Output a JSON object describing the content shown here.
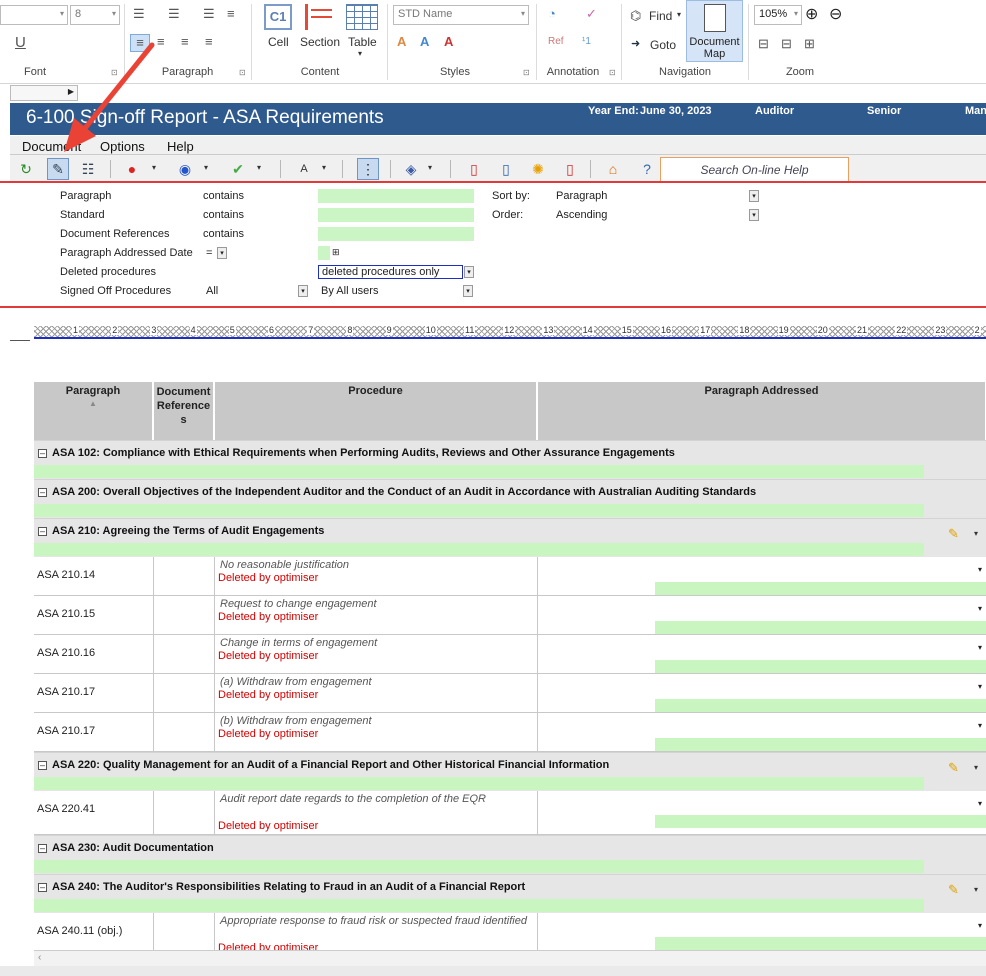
{
  "ribbon": {
    "font_size_value": "8",
    "groups": {
      "font": "Font",
      "paragraph": "Paragraph",
      "content": "Content",
      "styles": "Styles",
      "annotation": "Annotation",
      "navigation": "Navigation",
      "zoom": "Zoom"
    },
    "content_buttons": {
      "cell": "Cell",
      "section": "Section",
      "table": "Table",
      "cell_icon": "C1"
    },
    "style_value": "STD Name",
    "underline_label": "U",
    "find_label": "Find",
    "goto_label": "Goto",
    "docmap_label": "Document Map",
    "zoom_value": "105%"
  },
  "window": {
    "title": "6-100 Sign-off Report - ASA Requirements",
    "year_end_label": "Year End:",
    "year_end_value": "June 30, 2023",
    "auditor_label": "Auditor",
    "senior_label": "Senior",
    "man_label": "Man"
  },
  "menu": {
    "document": "Document",
    "options": "Options",
    "help": "Help"
  },
  "toolbar": {
    "help_placeholder": "Search On-line Help"
  },
  "filter": {
    "fields": [
      {
        "label": "Paragraph",
        "op": "contains"
      },
      {
        "label": "Standard",
        "op": "contains"
      },
      {
        "label": "Document References",
        "op": "contains"
      },
      {
        "label": "Paragraph Addressed Date",
        "op": "="
      },
      {
        "label": "Deleted procedures",
        "value": "deleted procedures only"
      },
      {
        "label": "Signed Off Procedures",
        "op": "All",
        "value": "By All users"
      }
    ],
    "sort_by_label": "Sort by:",
    "sort_by_value": "Paragraph",
    "order_label": "Order:",
    "order_value": "Ascending"
  },
  "ruler": [
    "1",
    "2",
    "3",
    "4",
    "5",
    "6",
    "7",
    "8",
    "9",
    "10",
    "11",
    "12",
    "13",
    "14",
    "15",
    "16",
    "17",
    "18",
    "19",
    "20",
    "21",
    "22",
    "23",
    "2"
  ],
  "table": {
    "headers": {
      "paragraph": "Paragraph",
      "docref": "Document Reference s",
      "procedure": "Procedure",
      "addressed": "Paragraph Addressed",
      "sort_arrow": "▲"
    },
    "sections": [
      {
        "title": "ASA 102: Compliance with Ethical Requirements when Performing Audits, Reviews and Other Assurance Engagements",
        "pen": false,
        "rows": []
      },
      {
        "title": "ASA 200: Overall Objectives of the Independent Auditor and the Conduct of an Audit in Accordance with Australian Auditing Standards",
        "pen": false,
        "rows": []
      },
      {
        "title": "ASA 210: Agreeing the Terms of Audit Engagements",
        "pen": true,
        "rows": [
          {
            "para": "ASA 210.14",
            "proc": "No reasonable justification",
            "status": "Deleted by optimiser"
          },
          {
            "para": "ASA 210.15",
            "proc": "Request to change engagement",
            "status": "Deleted by optimiser"
          },
          {
            "para": "ASA 210.16",
            "proc": "Change in terms of engagement",
            "status": "Deleted by optimiser"
          },
          {
            "para": "ASA 210.17",
            "proc": "(a) Withdraw from engagement",
            "status": "Deleted by optimiser"
          },
          {
            "para": "ASA 210.17",
            "proc": "(b) Withdraw from engagement",
            "status": "Deleted by optimiser"
          }
        ]
      },
      {
        "title": "ASA 220: Quality Management for an Audit of a Financial Report and Other Historical Financial Information",
        "pen": true,
        "rows": [
          {
            "para": "ASA 220.41",
            "proc": "Audit report date regards to the completion of the EQR",
            "status": "Deleted by optimiser"
          }
        ]
      },
      {
        "title": "ASA 230: Audit Documentation",
        "pen": false,
        "rows": []
      },
      {
        "title": "ASA 240: The Auditor's Responsibilities Relating to Fraud in an Audit of a Financial Report",
        "pen": true,
        "rows": [
          {
            "para": "ASA 240.11 (obj.)",
            "proc": "Appropriate response to fraud risk or suspected fraud identified",
            "status": "Deleted by optimiser"
          }
        ]
      }
    ]
  },
  "colors": {
    "title_bar": "#2f5a8e",
    "green_field": "#c8f5c0",
    "deleted_red": "#d40000",
    "annotation_arrow": "#e23a3a"
  }
}
